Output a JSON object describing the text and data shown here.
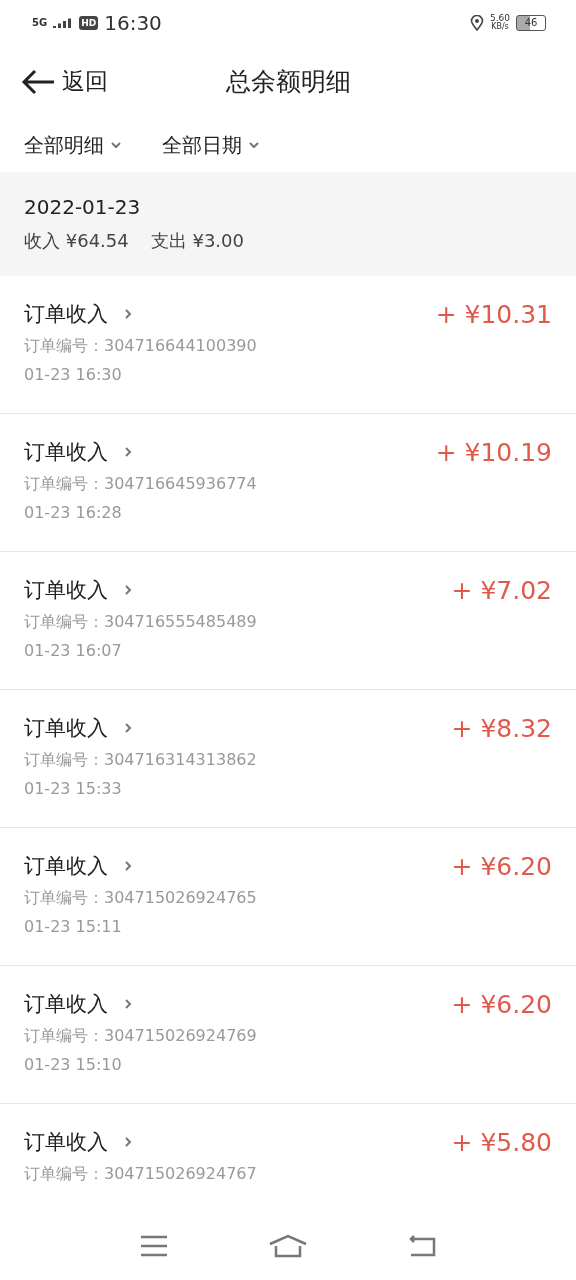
{
  "status_bar": {
    "network": "5G",
    "hd": "HD",
    "time": "16:30",
    "speed_value": "5.60",
    "speed_unit": "KB/s",
    "battery": "46"
  },
  "header": {
    "back_label": "返回",
    "title": "总余额明细"
  },
  "filters": [
    {
      "label": "全部明细"
    },
    {
      "label": "全部日期"
    }
  ],
  "summary": {
    "date": "2022-01-23",
    "income": "收入 ¥64.54",
    "expense": "支出 ¥3.00"
  },
  "transactions": [
    {
      "title": "订单收入",
      "order": "订单编号：304716644100390",
      "time": "01-23 16:30",
      "amount": "+ ¥10.31"
    },
    {
      "title": "订单收入",
      "order": "订单编号：304716645936774",
      "time": "01-23 16:28",
      "amount": "+ ¥10.19"
    },
    {
      "title": "订单收入",
      "order": "订单编号：304716555485489",
      "time": "01-23 16:07",
      "amount": "+ ¥7.02"
    },
    {
      "title": "订单收入",
      "order": "订单编号：304716314313862",
      "time": "01-23 15:33",
      "amount": "+ ¥8.32"
    },
    {
      "title": "订单收入",
      "order": "订单编号：304715026924765",
      "time": "01-23 15:11",
      "amount": "+ ¥6.20"
    },
    {
      "title": "订单收入",
      "order": "订单编号：304715026924769",
      "time": "01-23 15:10",
      "amount": "+ ¥6.20"
    },
    {
      "title": "订单收入",
      "order": "订单编号：304715026924767",
      "amount": "+ ¥5.80"
    }
  ]
}
